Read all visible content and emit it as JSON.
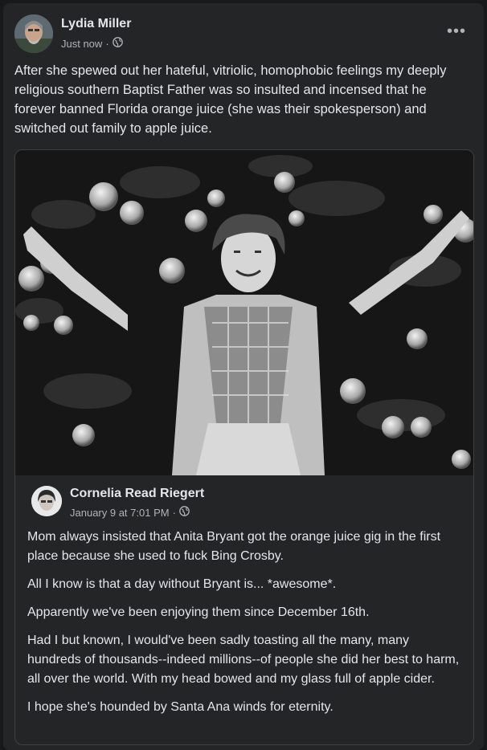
{
  "post": {
    "author": "Lydia Miller",
    "time": "Just now",
    "separator": "·",
    "privacy_icon": "globe-icon",
    "more_label": "•••",
    "text": "After she spewed out her hateful, vitriolic, homophobic feelings my deeply religious southern Baptist Father was so insulted and incensed that he forever banned Florida orange juice (she was their spokesperson) and switched out family to apple juice."
  },
  "shared": {
    "author": "Cornelia Read Riegert",
    "time": "January 9 at 7:01 PM",
    "separator": "·",
    "privacy_icon": "globe-icon",
    "paragraphs": [
      "Mom always insisted that Anita Bryant got the orange juice gig in the first place because she used to fuck Bing Crosby.",
      "All I know is that a day without Bryant is... *awesome*.",
      "Apparently we've been enjoying them since December 16th.",
      "Had I but known, I would've been sadly toasting all the many, many hundreds of thousands--indeed millions--of people she did her best to harm, all over the world. With my head bowed and my glass full of apple cider.",
      "I hope she's hounded by Santa Ana winds for eternity."
    ]
  },
  "colors": {
    "background": "#18191a",
    "card": "#242526",
    "text_primary": "#e4e6eb",
    "text_secondary": "#b0b3b8",
    "border": "#3e4042"
  }
}
